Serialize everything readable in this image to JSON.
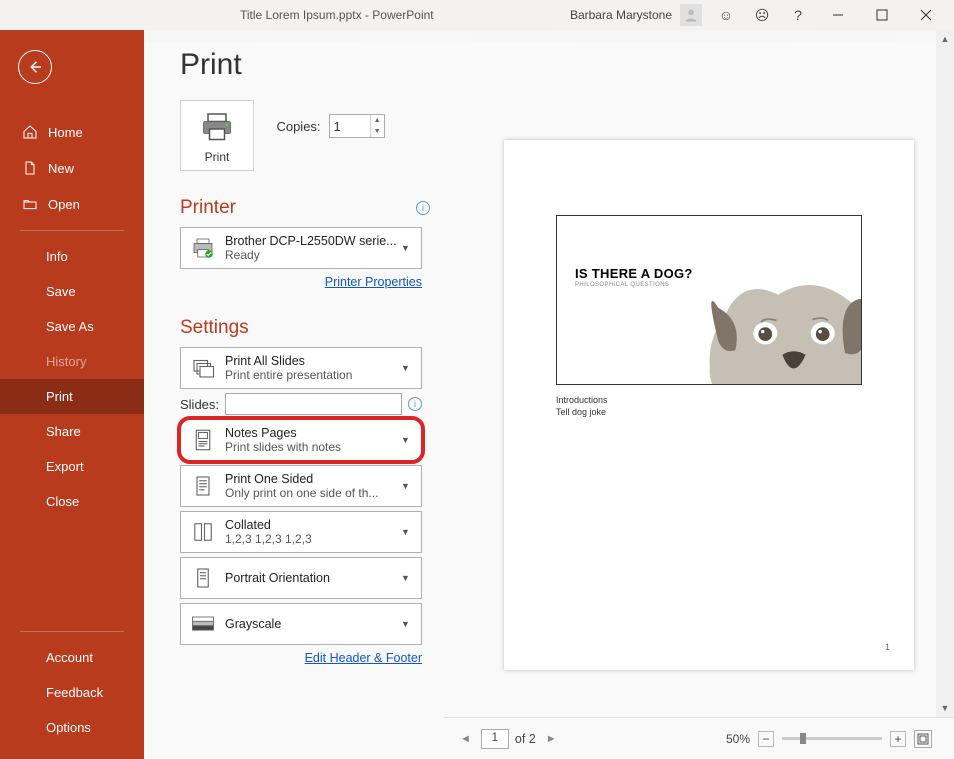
{
  "titlebar": {
    "title": "Title Lorem Ipsum.pptx  -  PowerPoint",
    "user": "Barbara Marystone"
  },
  "sidebar": {
    "home": "Home",
    "new": "New",
    "open": "Open",
    "info": "Info",
    "save": "Save",
    "saveas": "Save As",
    "history": "History",
    "print": "Print",
    "share": "Share",
    "export": "Export",
    "close": "Close",
    "account": "Account",
    "feedback": "Feedback",
    "options": "Options"
  },
  "page": {
    "heading": "Print",
    "print_button": "Print",
    "copies_label": "Copies:",
    "copies_value": "1",
    "printer_title": "Printer",
    "printer_name": "Brother DCP-L2550DW serie...",
    "printer_status": "Ready",
    "printer_properties": "Printer Properties",
    "settings_title": "Settings",
    "slides_label": "Slides:",
    "edit_header_footer": "Edit Header & Footer"
  },
  "settings": {
    "what": {
      "title": "Print All Slides",
      "sub": "Print entire presentation"
    },
    "layout": {
      "title": "Notes Pages",
      "sub": "Print slides with notes"
    },
    "sides": {
      "title": "Print One Sided",
      "sub": "Only print on one side of th..."
    },
    "collate": {
      "title": "Collated",
      "sub": "1,2,3    1,2,3    1,2,3"
    },
    "orient": {
      "title": "Portrait Orientation"
    },
    "color": {
      "title": "Grayscale"
    }
  },
  "preview": {
    "slide_title": "IS THERE A DOG?",
    "slide_subtitle": "PHILOSOPHICAL QUESTIONS",
    "note1": "Introductions",
    "note2": "Tell dog joke",
    "page_number": "1"
  },
  "bottombar": {
    "current_page": "1",
    "of": "of 2",
    "zoom": "50%"
  }
}
